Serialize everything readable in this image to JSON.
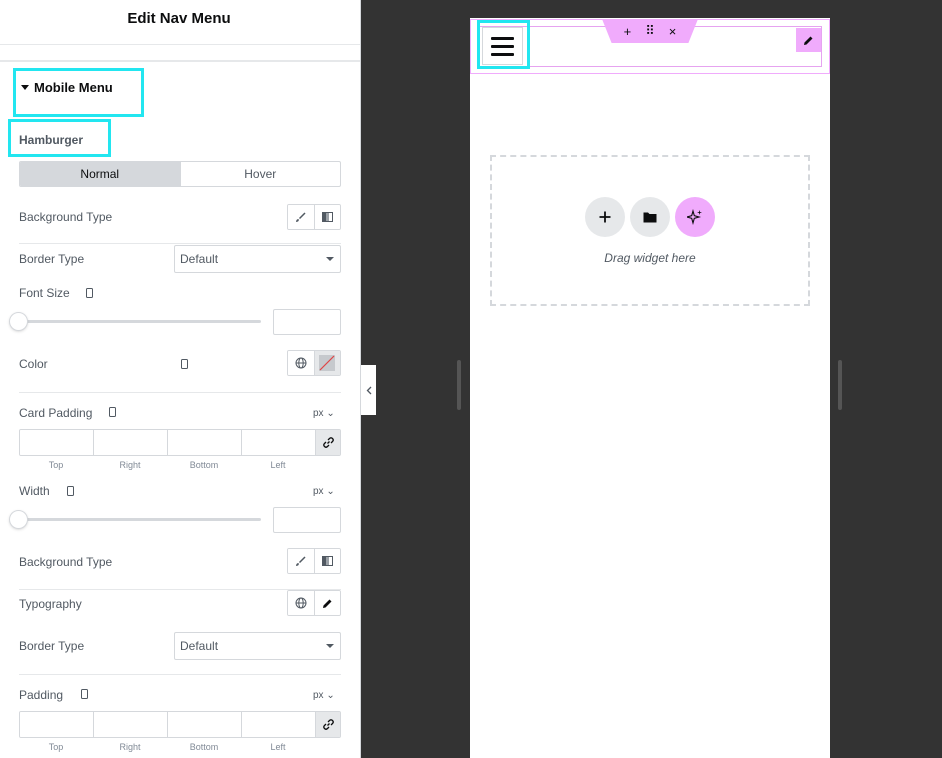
{
  "panel": {
    "title": "Edit Nav Menu",
    "section_title": "Mobile Menu",
    "subsection_title": "Hamburger",
    "tabs": [
      {
        "label": "Normal"
      },
      {
        "label": "Hover"
      }
    ],
    "background_type_label": "Background Type",
    "border_type_label": "Border Type",
    "border_type_value": "Default",
    "font_size_label": "Font Size",
    "color_label": "Color",
    "card_padding_label": "Card Padding",
    "unit_px": "px",
    "dimension_labels": [
      "Top",
      "Right",
      "Bottom",
      "Left"
    ],
    "width_label": "Width",
    "background_type_label_2": "Background Type",
    "typography_label": "Typography",
    "border_type_label_2": "Border Type",
    "border_type_value_2": "Default",
    "padding_label": "Padding"
  },
  "canvas": {
    "toolbar": {
      "add_icon": "+",
      "drag_icon": "⠿",
      "close_icon": "×"
    },
    "drag_widget_text": "Drag widget here"
  },
  "colors": {
    "accent_cyan": "#22e6f0",
    "element_pink": "#f0abfc",
    "canvas_bg": "#333333"
  }
}
